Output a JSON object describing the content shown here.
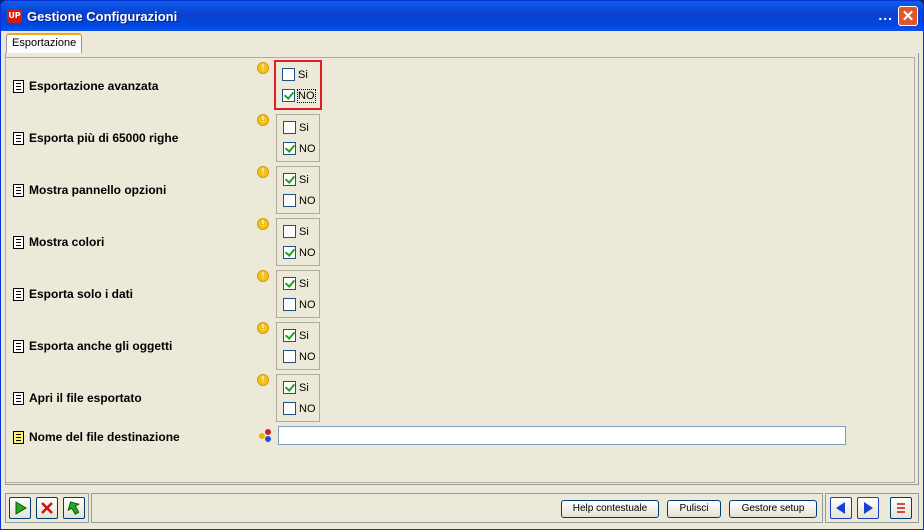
{
  "window": {
    "title": "Gestione Configurazioni",
    "logo_text": "UP",
    "menu_dots": "...",
    "close_symbol": "✕"
  },
  "tabs": [
    {
      "label": "Esportazione"
    }
  ],
  "hint_icon": "!",
  "settings": [
    {
      "label": "Esportazione avanzata",
      "options": [
        {
          "label": "Si",
          "checked": false
        },
        {
          "label": "NO",
          "checked": true
        }
      ],
      "focused": true
    },
    {
      "label": "Esporta più di 65000 righe",
      "options": [
        {
          "label": "Si",
          "checked": false
        },
        {
          "label": "NO",
          "checked": true
        }
      ]
    },
    {
      "label": "Mostra pannello opzioni",
      "options": [
        {
          "label": "Si",
          "checked": true
        },
        {
          "label": "NO",
          "checked": false
        }
      ]
    },
    {
      "label": "Mostra colori",
      "options": [
        {
          "label": "Si",
          "checked": false
        },
        {
          "label": "NO",
          "checked": true
        }
      ]
    },
    {
      "label": "Esporta solo i dati",
      "options": [
        {
          "label": "Si",
          "checked": true
        },
        {
          "label": "NO",
          "checked": false
        }
      ]
    },
    {
      "label": "Esporta anche gli oggetti",
      "options": [
        {
          "label": "Si",
          "checked": true
        },
        {
          "label": "NO",
          "checked": false
        }
      ]
    },
    {
      "label": "Apri il file esportato",
      "options": [
        {
          "label": "Si",
          "checked": true
        },
        {
          "label": "NO",
          "checked": false
        }
      ]
    }
  ],
  "filename_field": {
    "label": "Nome del file destinazione",
    "value": ""
  },
  "footer": {
    "help_label": "Help contestuale",
    "clear_label": "Pulisci",
    "setup_label": "Gestore setup"
  },
  "colors": {
    "titlebar": "#0a3fd0",
    "accent_red": "#e02020",
    "check_green": "#21a121"
  }
}
